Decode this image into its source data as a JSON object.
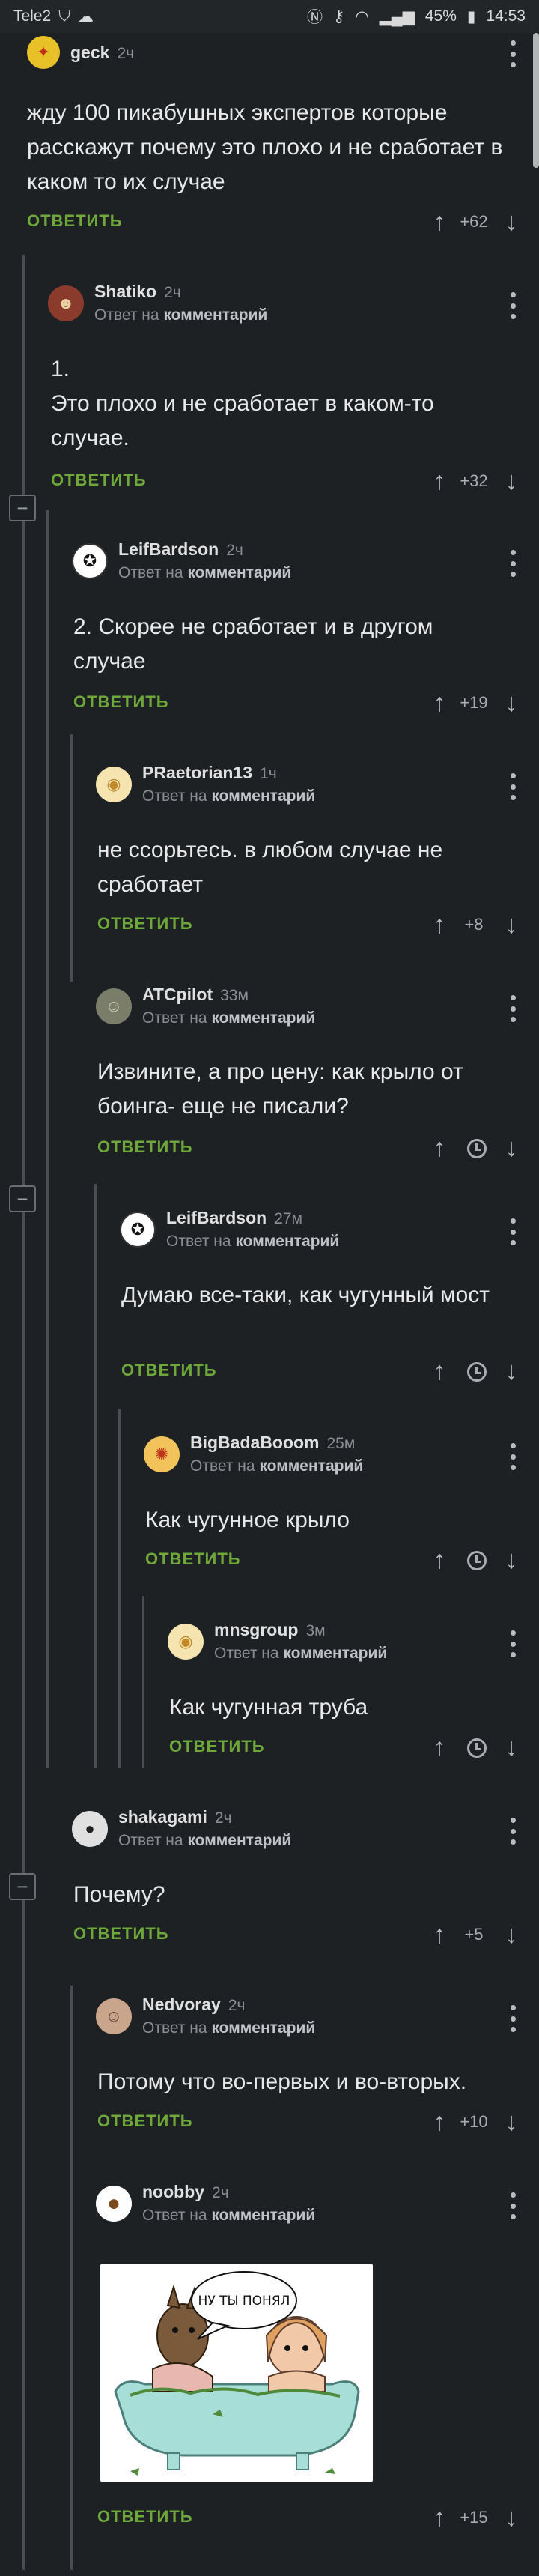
{
  "status_bar": {
    "carrier": "Tele2",
    "battery": "45%",
    "time": "14:53"
  },
  "labels": {
    "reply_to": "Ответ на",
    "comment": "комментарий",
    "reply_action": "ОТВЕТИТЬ",
    "collapse": "−"
  },
  "comments": [
    {
      "username": "geck",
      "time": "2ч",
      "text": "жду 100 пикабушных экспертов которые расскажут почему это плохо и не сработает  в каком то их случае",
      "rating": "+62",
      "avatar_color": "#e8c027"
    },
    {
      "username": "Shatiko",
      "time": "2ч",
      "text": "1.\nЭто плохо и не сработает в каком-то случае.",
      "rating": "+32",
      "avatar_color": "#8a3b2c"
    },
    {
      "username": "LeifBardson",
      "time": "2ч",
      "text": "2. Скорее не сработает и в другом случае",
      "rating": "+19",
      "avatar_color": "#ffffff"
    },
    {
      "username": "PRaetorian13",
      "time": "1ч",
      "text": "не ссорьтесь. в любом случае не сработает",
      "rating": "+8",
      "avatar_color": "#f6e4b0"
    },
    {
      "username": "ATCpilot",
      "time": "33м",
      "text": "Извините, а про цену: как крыло от боинга- еще не писали?",
      "rating": "",
      "avatar_color": "#7a7d6a"
    },
    {
      "username": "LeifBardson",
      "time": "27м",
      "text": "Думаю все-таки, как чугунный мост",
      "rating": "",
      "avatar_color": "#ffffff"
    },
    {
      "username": "BigBadaBooom",
      "time": "25м",
      "text": "Как чугунное крыло",
      "rating": "",
      "avatar_color": "#f2c35b"
    },
    {
      "username": "mnsgroup",
      "time": "3м",
      "text": "Как чугунная труба",
      "rating": "",
      "avatar_color": "#f6e4b0"
    },
    {
      "username": "shakagami",
      "time": "2ч",
      "text": "Почему?",
      "rating": "+5",
      "avatar_color": "#e0e0e0"
    },
    {
      "username": "Nedvoray",
      "time": "2ч",
      "text": "Потому что во-первых и во-вторых.",
      "rating": "+10",
      "avatar_color": "#c9a58b"
    },
    {
      "username": "noobby",
      "time": "2ч",
      "text": "",
      "rating": "+15",
      "avatar_color": "#ffffff"
    }
  ],
  "image": {
    "speech_bubble": "НУ ТЫ ПОНЯЛ"
  }
}
